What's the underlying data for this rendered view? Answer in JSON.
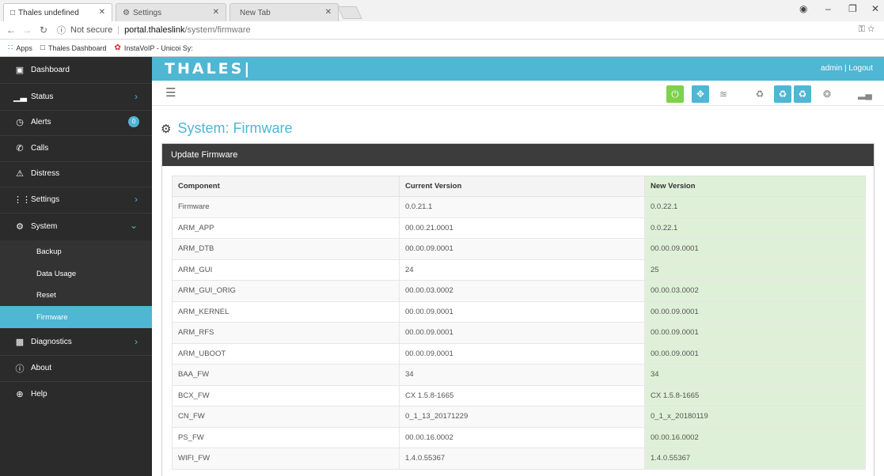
{
  "browser": {
    "tabs": [
      {
        "title": "Thales undefined",
        "icon": "page-icon"
      },
      {
        "title": "Settings",
        "icon": "gear-icon"
      },
      {
        "title": "New Tab",
        "icon": ""
      }
    ],
    "address": {
      "security": "Not secure",
      "host": "portal.thaleslink",
      "path": "/system/firmware"
    },
    "bookmarks": [
      {
        "label": "Apps",
        "icon": "apps-grid-icon"
      },
      {
        "label": "Thales Dashboard",
        "icon": "page-icon"
      },
      {
        "label": "InstaVoIP - Unicoi Sy:",
        "icon": "instavoip-logo-icon"
      }
    ]
  },
  "header": {
    "logo": "THALES|",
    "user_links": "admin | Logout"
  },
  "sidebar": {
    "items": [
      {
        "label": "Dashboard",
        "icon": "monitor-icon"
      },
      {
        "label": "Status",
        "icon": "bar-chart-icon"
      },
      {
        "label": "Alerts",
        "icon": "clock-icon",
        "badge": "0"
      },
      {
        "label": "Calls",
        "icon": "phone-icon"
      },
      {
        "label": "Distress",
        "icon": "warning-icon"
      },
      {
        "label": "Settings",
        "icon": "sliders-icon"
      },
      {
        "label": "System",
        "icon": "gear-icon"
      },
      {
        "label": "Diagnostics",
        "icon": "toolbox-icon"
      },
      {
        "label": "About",
        "icon": "info-icon"
      },
      {
        "label": "Help",
        "icon": "lifebuoy-icon"
      }
    ],
    "system_sub": [
      {
        "label": "Backup"
      },
      {
        "label": "Data Usage"
      },
      {
        "label": "Reset"
      },
      {
        "label": "Firmware"
      }
    ]
  },
  "page": {
    "title": "System: Firmware",
    "panel_title": "Update Firmware"
  },
  "firmware_table": {
    "headers": [
      "Component",
      "Current Version",
      "New Version"
    ],
    "rows": [
      [
        "Firmware",
        "0.0.21.1",
        "0.0.22.1"
      ],
      [
        "ARM_APP",
        "00.00.21.0001",
        "0.0.22.1"
      ],
      [
        "ARM_DTB",
        "00.00.09.0001",
        "00.00.09.0001"
      ],
      [
        "ARM_GUI",
        "24",
        "25"
      ],
      [
        "ARM_GUI_ORIG",
        "00.00.03.0002",
        "00.00.03.0002"
      ],
      [
        "ARM_KERNEL",
        "00.00.09.0001",
        "00.00.09.0001"
      ],
      [
        "ARM_RFS",
        "00.00.09.0001",
        "00.00.09.0001"
      ],
      [
        "ARM_UBOOT",
        "00.00.09.0001",
        "00.00.09.0001"
      ],
      [
        "BAA_FW",
        "34",
        "34"
      ],
      [
        "BCX_FW",
        "CX 1.5.8-1665",
        "CX 1.5.8-1665"
      ],
      [
        "CN_FW",
        "0_1_13_20171229",
        "0_1_x_20180119"
      ],
      [
        "PS_FW",
        "00.00.16.0002",
        "00.00.16.0002"
      ],
      [
        "WIFI_FW",
        "1.4.0.55367",
        "1.4.0.55367"
      ]
    ]
  },
  "colors": {
    "accent": "#4fb6d3",
    "sidebar_bg": "#2b2b2b",
    "new_version_bg": "#dff0d8",
    "power_green": "#7ed14a"
  }
}
